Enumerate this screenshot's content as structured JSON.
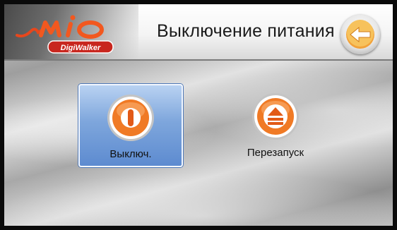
{
  "header": {
    "title": "Выключение питания",
    "logo_text": "Mio",
    "logo_badge": "DigiWalker"
  },
  "actions": {
    "shutdown_label": "Выключ.",
    "restart_label": "Перезапуск"
  },
  "colors": {
    "accent_orange": "#f07a25",
    "selection_blue": "#6f9ad6"
  },
  "icons": {
    "back": "arrow-left-icon",
    "shutdown": "power-icon",
    "restart": "eject-icon"
  }
}
